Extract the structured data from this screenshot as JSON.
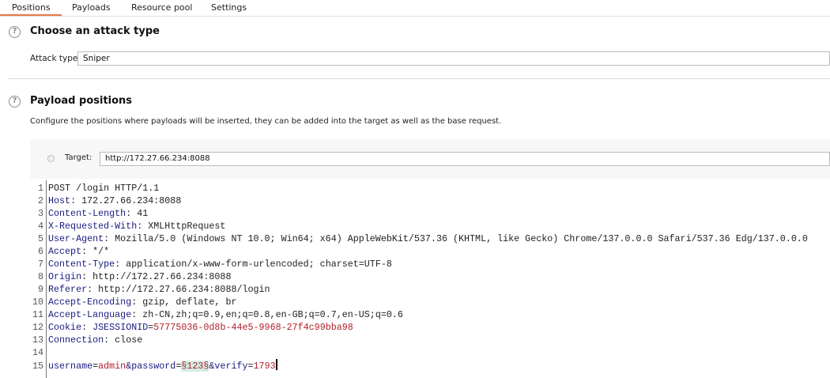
{
  "tabs": [
    {
      "label": "Positions",
      "active": true
    },
    {
      "label": "Payloads"
    },
    {
      "label": "Resource pool"
    },
    {
      "label": "Settings"
    }
  ],
  "accent_color": "#e8794b",
  "attack_section": {
    "help_icon": "?",
    "title": "Choose an attack type",
    "attack_type_label": "Attack type:",
    "attack_type_value": "Sniper"
  },
  "payload_section": {
    "help_icon": "?",
    "title": "Payload positions",
    "description": "Configure the positions where payloads will be inserted, they can be added into the target as well as the base request.",
    "target_label": "Target:",
    "target_value": "http://172.27.66.234:8088"
  },
  "request_lines": [
    [
      {
        "t": "POST /login HTTP/1.1",
        "c": "v"
      }
    ],
    [
      {
        "t": "Host",
        "c": "k"
      },
      {
        "t": ": 172.27.66.234:8088",
        "c": "v"
      }
    ],
    [
      {
        "t": "Content-Length",
        "c": "k"
      },
      {
        "t": ": 41",
        "c": "v"
      }
    ],
    [
      {
        "t": "X-Requested-With",
        "c": "k"
      },
      {
        "t": ": XMLHttpRequest",
        "c": "v"
      }
    ],
    [
      {
        "t": "User-Agent",
        "c": "k"
      },
      {
        "t": ": Mozilla/5.0 (Windows NT 10.0; Win64; x64) AppleWebKit/537.36 (KHTML, like Gecko) Chrome/137.0.0.0 Safari/537.36 Edg/137.0.0.0",
        "c": "v"
      }
    ],
    [
      {
        "t": "Accept",
        "c": "k"
      },
      {
        "t": ": */*",
        "c": "v"
      }
    ],
    [
      {
        "t": "Content-Type",
        "c": "k"
      },
      {
        "t": ": application/x-www-form-urlencoded; charset=UTF-8",
        "c": "v"
      }
    ],
    [
      {
        "t": "Origin",
        "c": "k"
      },
      {
        "t": ": http://172.27.66.234:8088",
        "c": "v"
      }
    ],
    [
      {
        "t": "Referer",
        "c": "k"
      },
      {
        "t": ": http://172.27.66.234:8088/login",
        "c": "v"
      }
    ],
    [
      {
        "t": "Accept-Encoding",
        "c": "k"
      },
      {
        "t": ": gzip, deflate, br",
        "c": "v"
      }
    ],
    [
      {
        "t": "Accept-Language",
        "c": "k"
      },
      {
        "t": ": zh-CN,zh;q=0.9,en;q=0.8,en-GB;q=0.7,en-US;q=0.6",
        "c": "v"
      }
    ],
    [
      {
        "t": "Cookie",
        "c": "k"
      },
      {
        "t": ": ",
        "c": "v"
      },
      {
        "t": "JSESSIONID",
        "c": "k"
      },
      {
        "t": "=",
        "c": "v"
      },
      {
        "t": "57775036-0d8b-44e5-9968-27f4c99bba98",
        "c": "r"
      }
    ],
    [
      {
        "t": "Connection",
        "c": "k"
      },
      {
        "t": ": close",
        "c": "v"
      }
    ],
    [],
    [
      {
        "t": "username",
        "c": "k"
      },
      {
        "t": "=",
        "c": "v"
      },
      {
        "t": "admin",
        "c": "r"
      },
      {
        "t": "&password",
        "c": "k"
      },
      {
        "t": "=",
        "c": "v"
      },
      {
        "t": "§123§",
        "c": "p"
      },
      {
        "t": "&verify",
        "c": "k"
      },
      {
        "t": "=",
        "c": "v"
      },
      {
        "t": "1793",
        "c": "r"
      }
    ]
  ]
}
